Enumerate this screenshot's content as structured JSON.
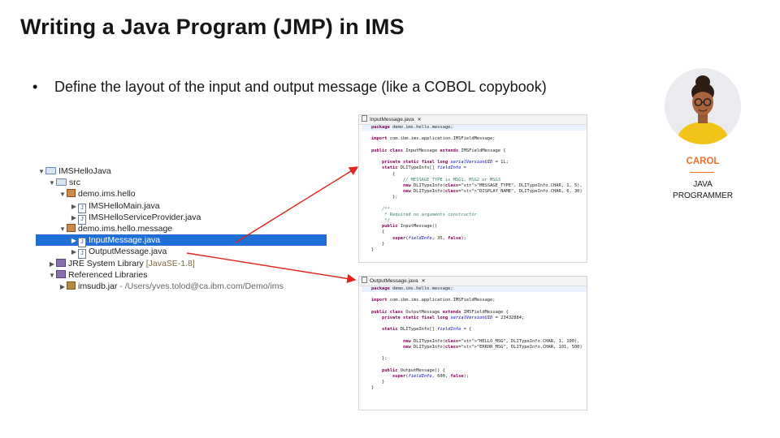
{
  "slide": {
    "title": "Writing a Java Program (JMP) in IMS",
    "bullet": "Define the layout of the input and output message (like a COBOL copybook)"
  },
  "tree": {
    "items": [
      {
        "label": "IMSHelloJava",
        "icon": "project-folder-icon",
        "twisty": "▼"
      },
      {
        "label": "src",
        "icon": "source-folder-icon",
        "twisty": "▼"
      },
      {
        "label": "demo.ims.hello",
        "icon": "package-icon",
        "twisty": "▼"
      },
      {
        "label": "IMSHelloMain.java",
        "icon": "java-file-icon",
        "twisty": "▶"
      },
      {
        "label": "IMSHelloServiceProvider.java",
        "icon": "java-file-icon",
        "twisty": "▶"
      },
      {
        "label": "demo.ims.hello.message",
        "icon": "package-icon",
        "twisty": "▼"
      },
      {
        "label": "InputMessage.java",
        "icon": "java-file-icon",
        "twisty": "▶",
        "selected": true
      },
      {
        "label": "OutputMessage.java",
        "icon": "java-file-icon",
        "twisty": "▶"
      },
      {
        "label": "JRE System Library",
        "suffix": "[JavaSE-1.8]",
        "icon": "library-icon",
        "twisty": "▶"
      },
      {
        "label": "Referenced Libraries",
        "icon": "library-icon",
        "twisty": "▼"
      },
      {
        "label": "imsudb.jar",
        "suffix": "- /Users/yves.tolod@ca.ibm.com/Demo/ims",
        "icon": "jar-icon",
        "twisty": "▶"
      }
    ]
  },
  "input_editor": {
    "tab": "InputMessage.java",
    "lines": [
      "package demo.ims.hello.message;",
      "",
      "import com.ibm.ims.application.IMSFieldMessage;",
      "",
      "public class InputMessage extends IMSFieldMessage {",
      "",
      "    private static final long serialVersionUID = 1L;",
      "    static DLITypeInfo[] fieldInfo =",
      "        {",
      "            // MESSAGE_TYPE is MSG1, MSG2 or MSG3",
      "            new DLITypeInfo(\"MESSAGE_TYPE\", DLITypeInfo.CHAR, 1, 5),",
      "            new DLITypeInfo(\"DISPLAY_NAME\", DLITypeInfo.CHAR, 6, 30)",
      "        };",
      "",
      "    /**",
      "     * Required no arguments constructor",
      "     */",
      "    public InputMessage()",
      "    {",
      "        super(fieldInfo, 35, false);",
      "    }",
      "}"
    ]
  },
  "output_editor": {
    "tab": "OutputMessage.java",
    "lines": [
      "package demo.ims.hello.message;",
      "",
      "import com.ibm.ims.application.IMSFieldMessage;",
      "",
      "public class OutputMessage extends IMSFieldMessage {",
      "    private static final long serialVersionUID = 23432884;",
      "",
      "    static DLITypeInfo[] fieldInfo = {",
      "",
      "            new DLITypeInfo(\"HELLO_MSG\", DLITypeInfo.CHAR, 1, 100),",
      "            new DLITypeInfo(\"ERROR_MSG\", DLITypeInfo.CHAR, 101, 500)",
      "",
      "    };",
      "",
      "    public OutputMessage() {",
      "        super(fieldInfo, 600, false);",
      "    }",
      "}"
    ]
  },
  "persona": {
    "name": "CAROL",
    "role_line1": "JAVA",
    "role_line2": "PROGRAMMER"
  },
  "colors": {
    "selection": "#1f6fd6",
    "arrow": "#e2231a",
    "persona_accent": "#e8702a"
  }
}
